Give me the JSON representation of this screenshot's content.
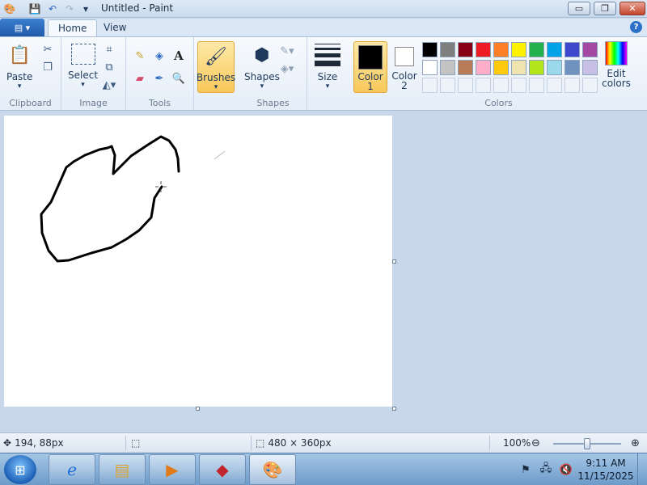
{
  "window": {
    "title": "Untitled - Paint",
    "controls": {
      "minimize": "▭",
      "maximize": "❐",
      "close": "✕"
    }
  },
  "quick_access": {
    "icons": [
      "paint-app-icon",
      "save-icon",
      "undo-icon",
      "redo-icon",
      "customize-icon"
    ]
  },
  "tabs": {
    "file_icon": "▤ ▾",
    "items": [
      {
        "label": "Home",
        "active": true
      },
      {
        "label": "View",
        "active": false
      }
    ],
    "help": "?"
  },
  "ribbon": {
    "clipboard": {
      "label": "Clipboard",
      "paste": "Paste"
    },
    "image": {
      "label": "Image",
      "select": "Select"
    },
    "tools": {
      "label": "Tools"
    },
    "brushes": {
      "label": "Brushes"
    },
    "shapes": {
      "label": "Shapes",
      "shapes_btn": "Shapes"
    },
    "size": {
      "label": "Size"
    },
    "colors": {
      "label": "Colors",
      "color1": "Color",
      "color1_num": "1",
      "color2": "Color",
      "color2_num": "2",
      "edit": "Edit",
      "edit2": "colors",
      "color1_value": "#000000",
      "color2_value": "#ffffff",
      "row1": [
        "#000000",
        "#7f7f7f",
        "#880015",
        "#ed1c24",
        "#ff7f27",
        "#fff200",
        "#22b14c",
        "#00a2e8",
        "#3f48cc",
        "#a349a4"
      ],
      "row2": [
        "#ffffff",
        "#c3c3c3",
        "#b97a57",
        "#ffaec9",
        "#ffc90e",
        "#efe4b0",
        "#b5e61d",
        "#99d9ea",
        "#7092be",
        "#c8bfe7"
      ]
    }
  },
  "statusbar": {
    "cursor_pos": "194, 88px",
    "selection": "",
    "canvas_size": "480 × 360px",
    "zoom": "100%"
  },
  "taskbar": {
    "time": "9:11 AM",
    "date": "11/15/2025"
  }
}
